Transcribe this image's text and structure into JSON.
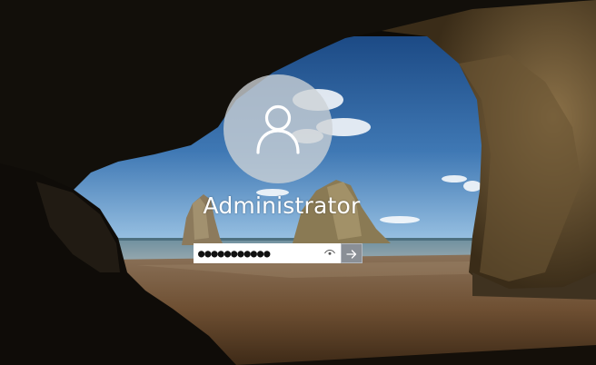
{
  "login": {
    "username": "Administrator",
    "password_masked": "●●●●●●●●●●●"
  },
  "icons": {
    "avatar": "user-silhouette-icon",
    "reveal": "eye-icon",
    "submit": "arrow-right-icon"
  },
  "colors": {
    "sky_top": "#1e4e86",
    "sky_bottom": "#8fb9de",
    "sea": "#5f7f8c",
    "sand": "#7a5a3c",
    "cave": "#141009",
    "rock_light": "#7b6340",
    "avatar_circle": "#cdd2d6",
    "submit_button": "#8a8f96",
    "text": "#ffffff"
  }
}
